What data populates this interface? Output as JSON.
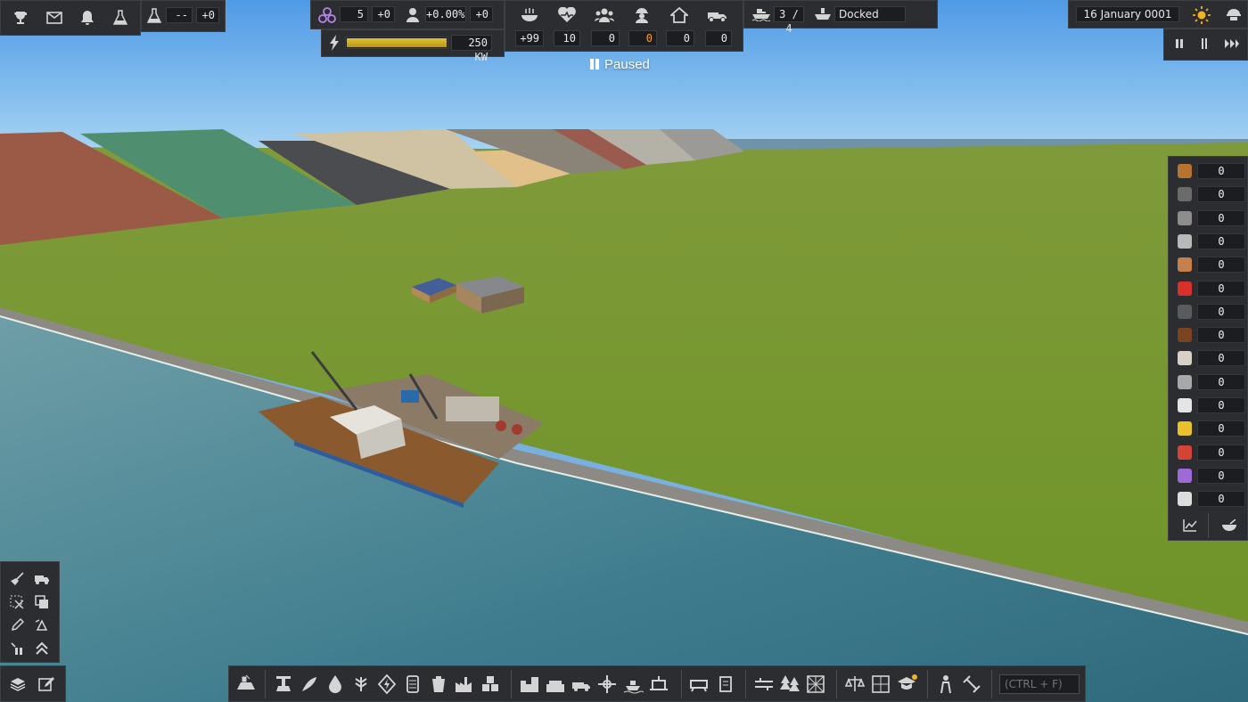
{
  "top_left": {
    "research_value": "--",
    "research_delta": "+0",
    "icons": [
      "trophy-icon",
      "mail-icon",
      "bell-icon",
      "flask-icon"
    ]
  },
  "top_center_left": {
    "unity_value": "5",
    "unity_delta": "+0",
    "population_growth": "+0.00%",
    "population_delta": "+0",
    "power_value": "250 KW",
    "power_fill": 1.0
  },
  "top_center": {
    "food_value": "+99",
    "health_value": "10",
    "population_value": "0",
    "workers_value": "0",
    "housing_value": "0",
    "vehicles_value": "0",
    "paused_label": "Paused"
  },
  "top_right_center": {
    "ships_value": "3 / 4",
    "ship_status": "Docked"
  },
  "top_right": {
    "date": "16 January 0001",
    "speed_buttons": [
      "pause",
      "play",
      "fast"
    ]
  },
  "inventory": {
    "items": [
      {
        "name": "wood",
        "value": "0",
        "color": "#b5742f"
      },
      {
        "name": "iron-ore",
        "value": "0",
        "color": "#6b6b6b"
      },
      {
        "name": "iron",
        "value": "0",
        "color": "#8d8d8d"
      },
      {
        "name": "steel",
        "value": "0",
        "color": "#b9b9b9"
      },
      {
        "name": "copper",
        "value": "0",
        "color": "#c7804a"
      },
      {
        "name": "fuel",
        "value": "0",
        "color": "#d8312b"
      },
      {
        "name": "construction-parts",
        "value": "0",
        "color": "#5b5b5b"
      },
      {
        "name": "food",
        "value": "0",
        "color": "#7a4420"
      },
      {
        "name": "meds",
        "value": "0",
        "color": "#d9d0c6"
      },
      {
        "name": "concrete",
        "value": "0",
        "color": "#a8a8a8"
      },
      {
        "name": "product-1",
        "value": "0",
        "color": "#e5e5e5"
      },
      {
        "name": "product-2",
        "value": "0",
        "color": "#e8c12b"
      },
      {
        "name": "product-3",
        "value": "0",
        "color": "#d24433"
      },
      {
        "name": "product-4",
        "value": "0",
        "color": "#9e6ad8"
      },
      {
        "name": "tools",
        "value": "0",
        "color": "#dddddd"
      }
    ]
  },
  "search": {
    "placeholder": "(CTRL + F)"
  }
}
